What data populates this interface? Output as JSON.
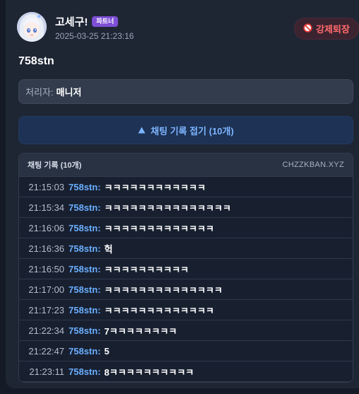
{
  "header": {
    "name": "고세구!",
    "badge": "파트너",
    "timestamp": "2025-03-25 21:23:16",
    "kick_label": "강제퇴장"
  },
  "target_user": "758stn",
  "handler": {
    "label": "처리자:",
    "value": "매니저"
  },
  "collapse_label": "채팅 기록 접기 (10개)",
  "log": {
    "title": "채팅 기록 (10개)",
    "site": "CHZZKBAN.XYZ",
    "rows": [
      {
        "time": "21:15:03",
        "user": "758stn:",
        "msg": "ㅋㅋㅋㅋㅋㅋㅋㅋㅋㅋㅋㅋ"
      },
      {
        "time": "21:15:34",
        "user": "758stn:",
        "msg": "ㅋㅋㅋㅋㅋㅋㅋㅋㅋㅋㅋㅋㅋㅋㅋ"
      },
      {
        "time": "21:16:06",
        "user": "758stn:",
        "msg": "ㅋㅋㅋㅋㅋㅋㅋㅋㅋㅋㅋㅋㅋ"
      },
      {
        "time": "21:16:36",
        "user": "758stn:",
        "msg": "헉"
      },
      {
        "time": "21:16:50",
        "user": "758stn:",
        "msg": "ㅋㅋㅋㅋㅋㅋㅋㅋㅋㅋ"
      },
      {
        "time": "21:17:00",
        "user": "758stn:",
        "msg": "ㅋㅋㅋㅋㅋㅋㅋㅋㅋㅋㅋㅋㅋㅋ"
      },
      {
        "time": "21:17:23",
        "user": "758stn:",
        "msg": "ㅋㅋㅋㅋㅋㅋㅋㅋㅋㅋㅋㅋㅋ"
      },
      {
        "time": "21:22:34",
        "user": "758stn:",
        "msg": "7ㅋㅋㅋㅋㅋㅋㅋㅋ"
      },
      {
        "time": "21:22:47",
        "user": "758stn:",
        "msg": "5"
      },
      {
        "time": "21:23:11",
        "user": "758stn:",
        "msg": "8ㅋㅋㅋㅋㅋㅋㅋㅋㅋㅋ"
      }
    ]
  },
  "colors": {
    "accent": "#6aaeff",
    "badge": "#7e4fd6",
    "danger": "#ff6b6b"
  }
}
